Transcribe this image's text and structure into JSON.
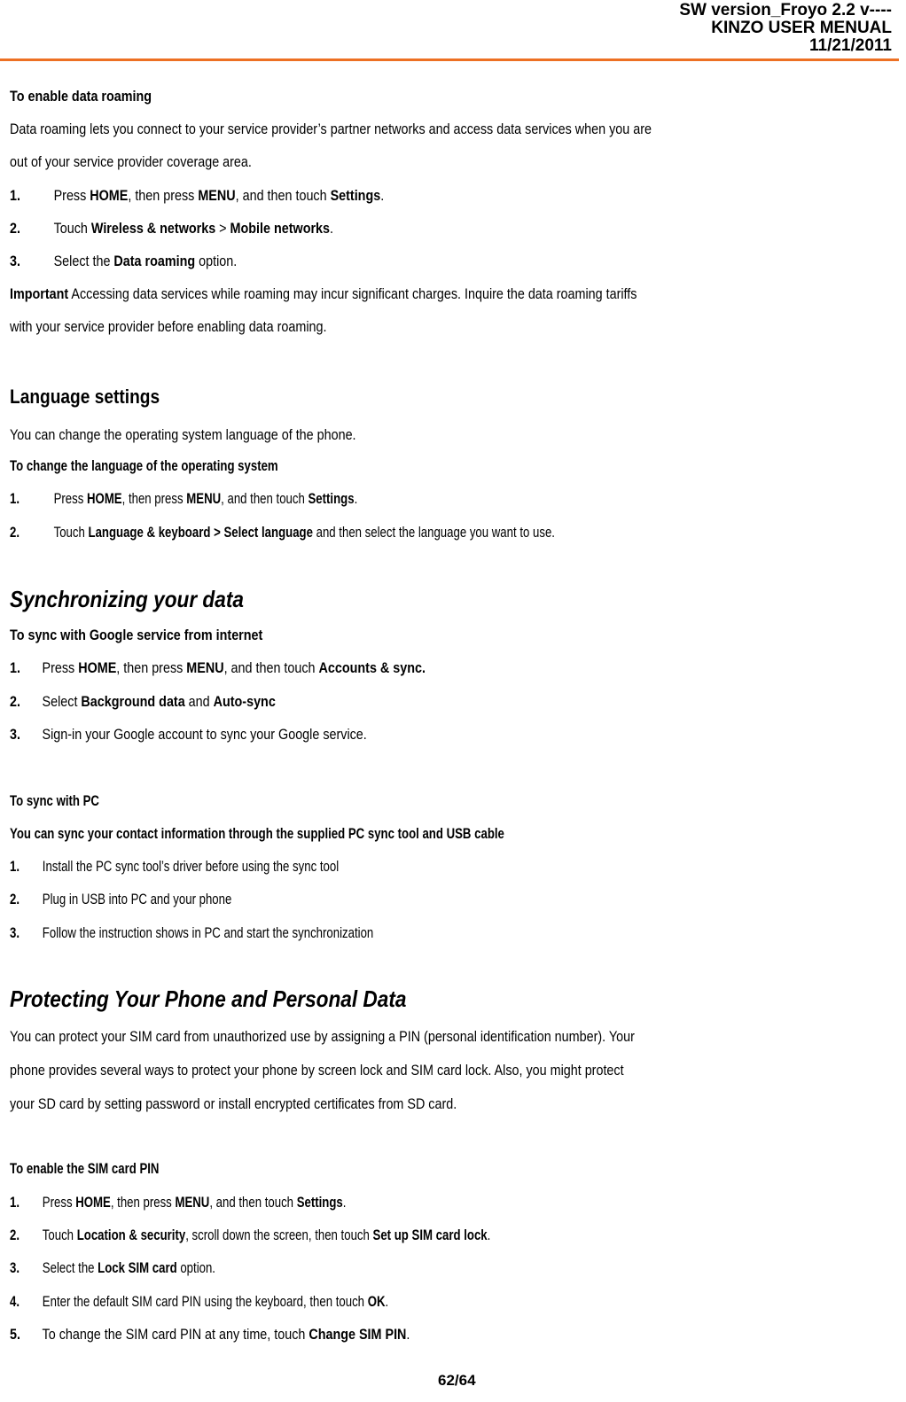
{
  "header": {
    "line1": "SW version_Froyo 2.2 v----",
    "line2": "KINZO USER MENUAL",
    "line3": "11/21/2011",
    "rule_color": "#ed7023"
  },
  "roaming": {
    "title": "To enable data roaming",
    "intro_1": "Data roaming lets you connect to your service provider’s partner networks and access data services when you are",
    "intro_2": "out of your service provider coverage area.",
    "steps": [
      {
        "num": "1.",
        "a": "Press ",
        "b1": "HOME",
        "c": ", then press ",
        "b2": "MENU",
        "d": ", and then touch ",
        "b3": "Settings",
        "e": "."
      },
      {
        "num": "2.",
        "a": "Touch ",
        "b1": "Wireless & networks",
        "c": " > ",
        "b2": "Mobile networks",
        "d": "."
      },
      {
        "num": "3.",
        "a": "Select the ",
        "b1": "Data roaming",
        "c": " option."
      }
    ],
    "important_label": "Important",
    "important_1": " Accessing data services while roaming may incur significant charges. Inquire the data roaming tariffs",
    "important_2": "with your service provider before enabling data roaming."
  },
  "language": {
    "heading": "Language settings",
    "intro": "You can change the operating system language of the phone.",
    "subtitle": "To change the language of the operating system",
    "steps": [
      {
        "num": "1.",
        "a": "Press ",
        "b1": "HOME",
        "c": ", then press ",
        "b2": "MENU",
        "d": ", and then touch ",
        "b3": "Settings",
        "e": "."
      },
      {
        "num": "2.",
        "a": "Touch ",
        "b1": "Language & keyboard > Select language",
        "c": " and then select the language you want to use."
      }
    ]
  },
  "sync": {
    "heading": "Synchronizing your data",
    "google_title": "To sync with Google service from internet",
    "google_steps": [
      {
        "num": "1.",
        "a": "Press ",
        "b1": "HOME",
        "c": ", then press ",
        "b2": "MENU",
        "d": ", and then touch ",
        "b3": "Accounts & sync."
      },
      {
        "num": "2.",
        "a": "Select ",
        "b1": "Background data",
        "c": " and ",
        "b2": "Auto-sync"
      },
      {
        "num": "3.",
        "a": "Sign-in your Google account to sync your Google service."
      }
    ],
    "pc_title": "To sync with PC",
    "pc_subtitle": "You can sync your contact information through the supplied PC sync tool and USB cable",
    "pc_steps": [
      {
        "num": "1.",
        "a": "Install the PC sync tool’s driver before using the sync tool"
      },
      {
        "num": "2.",
        "a": "Plug in USB into PC and your phone"
      },
      {
        "num": "3.",
        "a": "Follow the instruction shows in PC and start the synchronization"
      }
    ]
  },
  "protect": {
    "heading": "Protecting Your Phone and Personal Data",
    "para_1": "You can protect your SIM card from unauthorized use by assigning a PIN (personal identification number).  Your",
    "para_2": "phone provides several ways to protect your phone by screen lock and SIM card lock.  Also, you might protect",
    "para_3": "your SD card by setting password or install encrypted certificates from SD card.",
    "pin_title": "To enable the SIM card PIN",
    "pin_steps": [
      {
        "num": "1.",
        "a": "Press ",
        "b1": "HOME",
        "c": ", then press ",
        "b2": "MENU",
        "d": ", and then touch ",
        "b3": "Settings",
        "e": "."
      },
      {
        "num": "2.",
        "a": "Touch ",
        "b1": "Location & security",
        "c": ", scroll down the screen, then touch ",
        "b2": "Set up SIM card lock",
        "d": "."
      },
      {
        "num": "3.",
        "a": "Select the ",
        "b1": "Lock SIM card",
        "c": " option."
      },
      {
        "num": "4.",
        "a": "Enter the default SIM card PIN using the keyboard, then touch ",
        "b1": "OK",
        "c": "."
      },
      {
        "num": "5.",
        "a": "To change the SIM card PIN at any time, touch ",
        "b1": "Change SIM PIN",
        "c": "."
      }
    ]
  },
  "footer": {
    "page_number": "62/64"
  }
}
